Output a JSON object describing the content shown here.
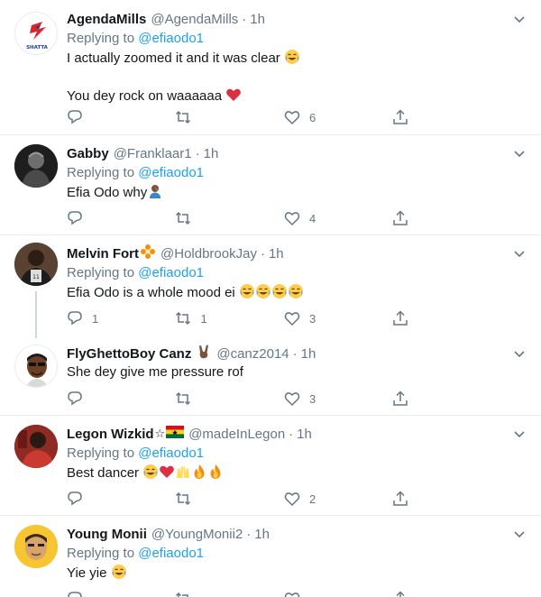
{
  "tweets": [
    {
      "name": "AgendaMills",
      "handle": "@AgendaMills",
      "time": "1h",
      "replying_prefix": "Replying to",
      "replying_to": "@efiaodo1",
      "lines": [
        "I actually zoomed it and it was clear",
        "You dey rock on waaaaaa"
      ],
      "replies": "",
      "retweets": "",
      "likes": "6",
      "avatar_text": "SHATTA"
    },
    {
      "name": "Gabby",
      "handle": "@Franklaar1",
      "time": "1h",
      "replying_prefix": "Replying to",
      "replying_to": "@efiaodo1",
      "lines": [
        "Efia Odo why"
      ],
      "replies": "",
      "retweets": "",
      "likes": "4"
    },
    {
      "name": "Melvin Fort",
      "handle": "@HoldbrookJay",
      "time": "1h",
      "replying_prefix": "Replying to",
      "replying_to": "@efiaodo1",
      "lines": [
        "Efia Odo is a whole mood ei"
      ],
      "replies": "1",
      "retweets": "1",
      "likes": "3"
    },
    {
      "name": "FlyGhettoBoy Canz",
      "handle": "@canz2014",
      "time": "1h",
      "lines": [
        "She dey give me pressure rof"
      ],
      "replies": "",
      "retweets": "",
      "likes": "3"
    },
    {
      "name": "Legon Wizkid",
      "handle": "@madeInLegon",
      "time": "1h",
      "replying_prefix": "Replying to",
      "replying_to": "@efiaodo1",
      "lines": [
        "Best dancer"
      ],
      "replies": "",
      "retweets": "",
      "likes": "2"
    },
    {
      "name": "Young Monii",
      "handle": "@YoungMonii2",
      "time": "1h",
      "replying_prefix": "Replying to",
      "replying_to": "@efiaodo1",
      "lines": [
        "Yie yie"
      ],
      "replies": "",
      "retweets": "",
      "likes": ""
    }
  ],
  "colors": {
    "accent": "#1da1f2",
    "secondary_text": "#657786",
    "border": "#e6ecf0",
    "thread_line": "#ccd6dd"
  },
  "icons": [
    "reply-icon",
    "retweet-icon",
    "like-icon",
    "share-icon",
    "chevron-down-icon"
  ]
}
